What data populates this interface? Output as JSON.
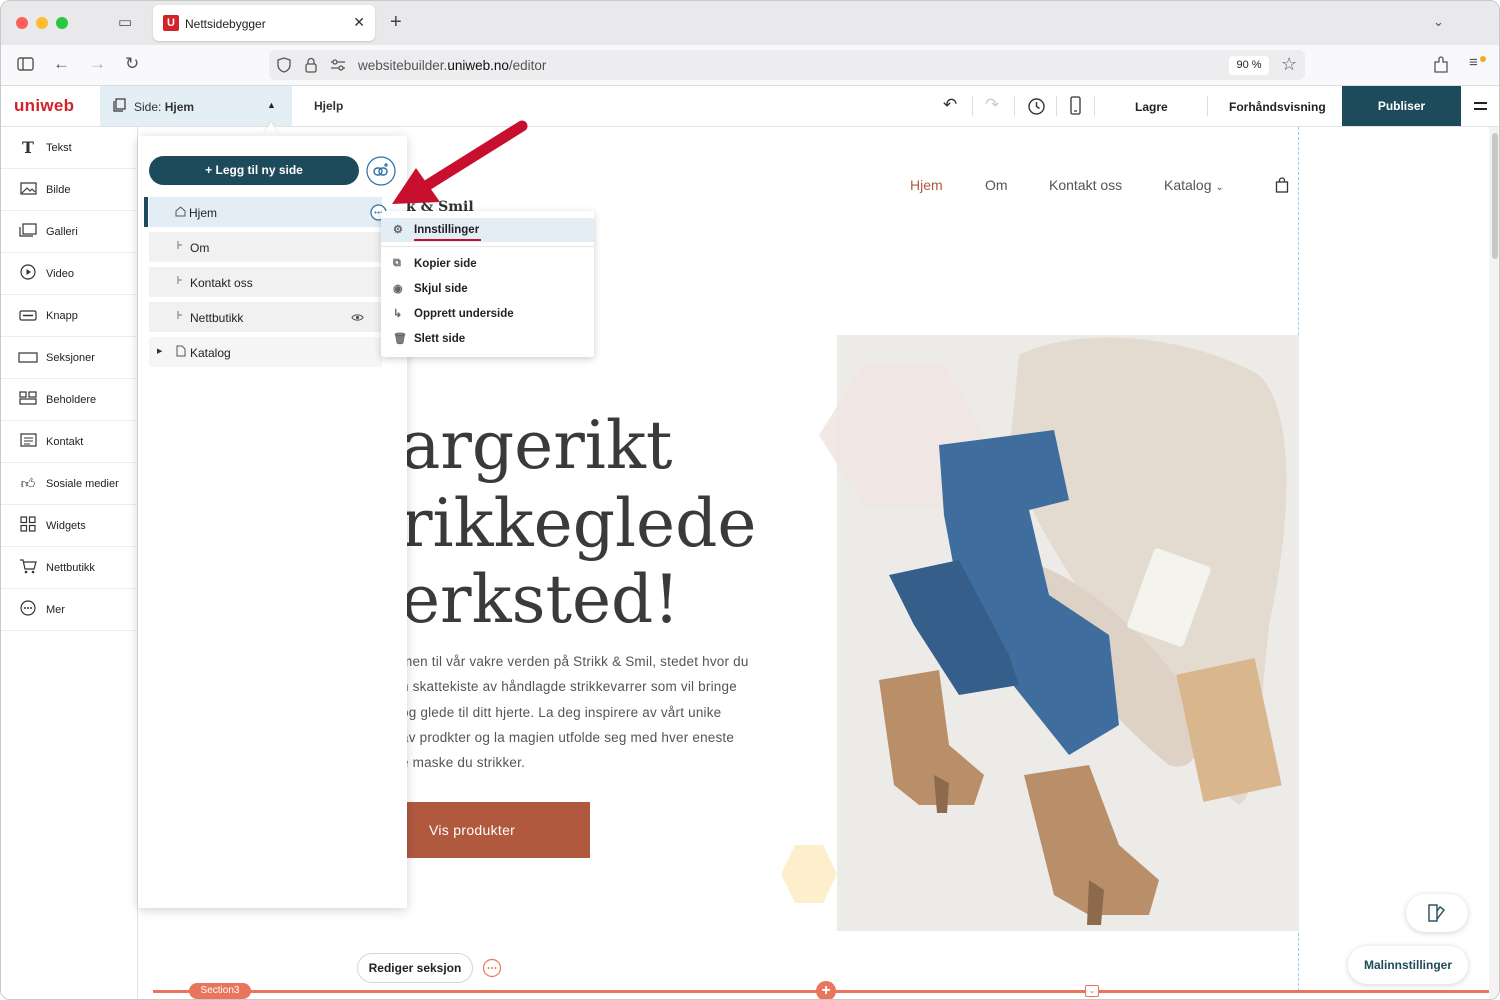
{
  "browser": {
    "tab_title": "Nettsidebygger",
    "tab_favicon": "U",
    "url_host_prefix": "websitebuilder.",
    "url_host_bold": "uniweb.no",
    "url_path": "/editor",
    "zoom": "90 %"
  },
  "app": {
    "logo": "uniweb",
    "page_selector_prefix": "Side:",
    "page_selector_value": "Hjem",
    "help": "Hjelp",
    "save": "Lagre",
    "preview": "Forhåndsvisning",
    "publish": "Publiser",
    "accent_color": "#1e4b5c"
  },
  "sidebar": {
    "items": [
      {
        "label": "Tekst",
        "icon": "text-icon"
      },
      {
        "label": "Bilde",
        "icon": "image-icon"
      },
      {
        "label": "Galleri",
        "icon": "gallery-icon"
      },
      {
        "label": "Video",
        "icon": "video-icon"
      },
      {
        "label": "Knapp",
        "icon": "button-icon"
      },
      {
        "label": "Seksjoner",
        "icon": "sections-icon"
      },
      {
        "label": "Beholdere",
        "icon": "containers-icon"
      },
      {
        "label": "Kontakt",
        "icon": "contact-icon"
      },
      {
        "label": "Sosiale medier",
        "icon": "thumbs-up-icon"
      },
      {
        "label": "Widgets",
        "icon": "widgets-icon"
      },
      {
        "label": "Nettbutikk",
        "icon": "cart-icon"
      },
      {
        "label": "Mer",
        "icon": "more-icon"
      }
    ]
  },
  "pages_panel": {
    "add_page": "+ Legg til ny side",
    "pages": [
      {
        "label": "Hjem",
        "active": true
      },
      {
        "label": "Om"
      },
      {
        "label": "Kontakt oss"
      },
      {
        "label": "Nettbutikk",
        "hidden": true
      },
      {
        "label": "Katalog",
        "expandable": true
      }
    ]
  },
  "context_menu": {
    "items": [
      {
        "label": "Innstillinger",
        "icon": "gear-icon",
        "highlighted": true
      },
      {
        "label": "Kopier side",
        "icon": "copy-icon"
      },
      {
        "label": "Skjul side",
        "icon": "eye-icon"
      },
      {
        "label": "Opprett underside",
        "icon": "subpage-icon"
      },
      {
        "label": "Slett side",
        "icon": "trash-icon"
      }
    ]
  },
  "site": {
    "brand_fragment": "k & Smil",
    "nav": [
      "Hjem",
      "Om",
      "Kontakt oss",
      "Katalog"
    ],
    "headline_lines": [
      "argerikt",
      "rikkeglede",
      "erksted!"
    ],
    "body_lines": [
      "men til vår vakre verden på Strikk & Smil, stedet hvor du",
      "n skattekiste av håndlagde strikkevarrer som vil bringe",
      "og glede til ditt hjerte. La deg inspirere av vårt unike",
      "av prodkter og la magien utfolde seg med hver eneste",
      "e maske du strikker."
    ],
    "cta": "Vis produkter",
    "cta_color": "#b0593f",
    "nav_active_color": "#b0593f"
  },
  "editor": {
    "edit_section": "Rediger seksjon",
    "section_tag": "Section3",
    "template_settings": "Malinnstillinger"
  }
}
